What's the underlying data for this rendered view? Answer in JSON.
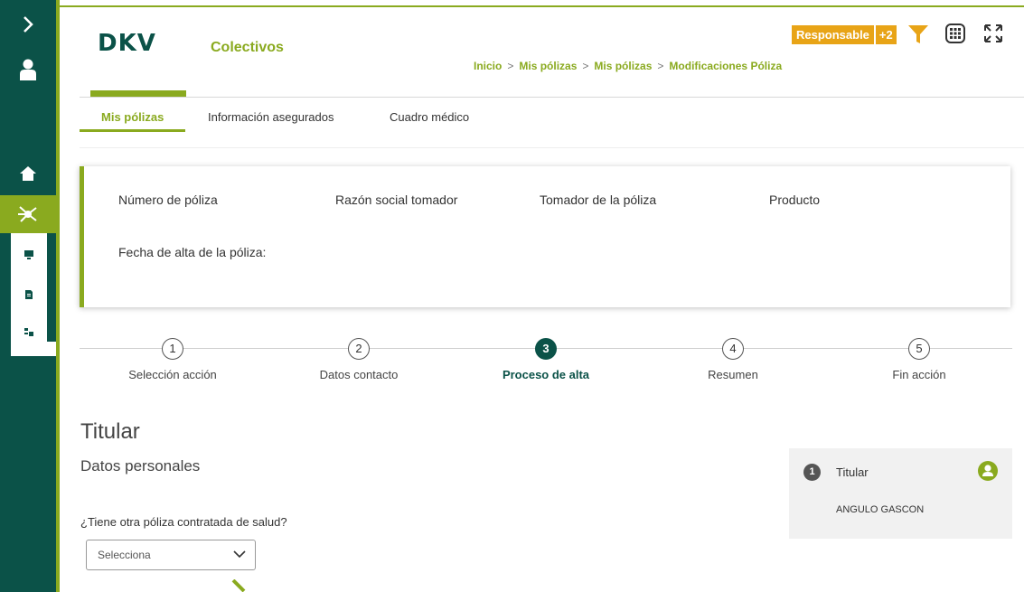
{
  "sidebar": {
    "toggle_icon": "chevron-right-icon",
    "user_icon": "user-icon",
    "home_icon": "home-icon",
    "network_icon": "network-icon",
    "sub_icons": [
      "monitor-icon",
      "document-icon",
      "people-list-icon"
    ]
  },
  "header": {
    "logo": "DKV",
    "app_name": "Colectivos",
    "breadcrumb": [
      "Inicio",
      "Mis pólizas",
      "Mis pólizas",
      "Modificaciones Póliza"
    ],
    "breadcrumb_sep": ">",
    "role_label": "Responsable",
    "role_extra": "+2"
  },
  "tabs": [
    {
      "label": "Mis pólizas",
      "active": true
    },
    {
      "label": "Información asegurados",
      "active": false
    },
    {
      "label": "Cuadro médico",
      "active": false
    }
  ],
  "policy": {
    "number_label": "Número de póliza",
    "company_label": "Razón social tomador",
    "holder_label": "Tomador de la póliza",
    "product_label": "Producto",
    "date_label": "Fecha de alta de la póliza:"
  },
  "steps": [
    {
      "num": "1",
      "label": "Selección acción",
      "active": false
    },
    {
      "num": "2",
      "label": "Datos contacto",
      "active": false
    },
    {
      "num": "3",
      "label": "Proceso de alta",
      "active": true
    },
    {
      "num": "4",
      "label": "Resumen",
      "active": false
    },
    {
      "num": "5",
      "label": "Fin acción",
      "active": false
    }
  ],
  "content": {
    "section_title": "Titular",
    "subsection_title": "Datos personales",
    "question": "¿Tiene otra póliza contratada de salud?",
    "select_value": "Selecciona"
  },
  "side_panel": {
    "number": "1",
    "title": "Titular",
    "name": "ANGULO GASCON"
  },
  "colors": {
    "brand_dark": "#0b5248",
    "brand_lime": "#8aaa1f",
    "accent_orange": "#e8a417"
  }
}
